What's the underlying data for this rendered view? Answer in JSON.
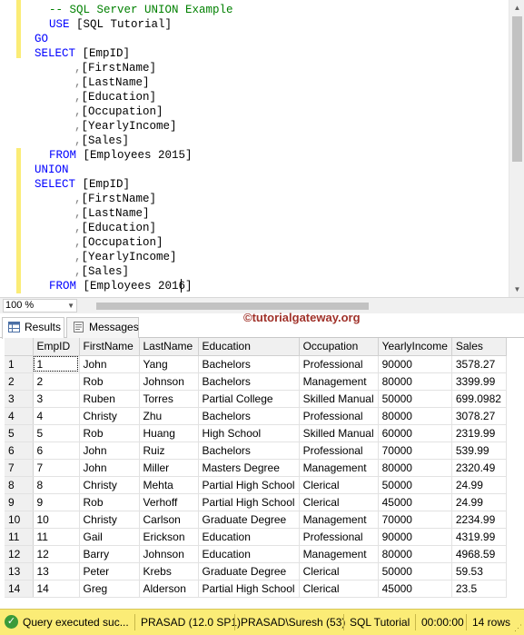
{
  "editor": {
    "lines": [
      {
        "parts": [
          {
            "cls": "cm",
            "t": "-- SQL Server UNION Example"
          }
        ],
        "indent": 54
      },
      {
        "parts": [
          {
            "cls": "kw",
            "t": "USE "
          },
          {
            "cls": "tx",
            "t": "[SQL Tutorial]"
          }
        ],
        "indent": 54
      },
      {
        "parts": [
          {
            "cls": "kw",
            "t": "GO"
          }
        ],
        "indent": 38
      },
      {
        "parts": [
          {
            "cls": "kw",
            "t": "SELECT "
          },
          {
            "cls": "tx",
            "t": "[EmpID]"
          }
        ],
        "indent": 38
      },
      {
        "parts": [
          {
            "cls": "gr",
            "t": ","
          },
          {
            "cls": "tx",
            "t": "[FirstName]"
          }
        ],
        "indent": 82
      },
      {
        "parts": [
          {
            "cls": "gr",
            "t": ","
          },
          {
            "cls": "tx",
            "t": "[LastName]"
          }
        ],
        "indent": 82
      },
      {
        "parts": [
          {
            "cls": "gr",
            "t": ","
          },
          {
            "cls": "tx",
            "t": "[Education]"
          }
        ],
        "indent": 82
      },
      {
        "parts": [
          {
            "cls": "gr",
            "t": ","
          },
          {
            "cls": "tx",
            "t": "[Occupation]"
          }
        ],
        "indent": 82
      },
      {
        "parts": [
          {
            "cls": "gr",
            "t": ","
          },
          {
            "cls": "tx",
            "t": "[YearlyIncome]"
          }
        ],
        "indent": 82
      },
      {
        "parts": [
          {
            "cls": "gr",
            "t": ","
          },
          {
            "cls": "tx",
            "t": "[Sales]"
          }
        ],
        "indent": 82
      },
      {
        "parts": [
          {
            "cls": "kw",
            "t": "FROM "
          },
          {
            "cls": "tx",
            "t": "[Employees 2015]"
          }
        ],
        "indent": 54
      },
      {
        "parts": [
          {
            "cls": "kw",
            "t": "UNION"
          }
        ],
        "indent": 38
      },
      {
        "parts": [
          {
            "cls": "kw",
            "t": "SELECT "
          },
          {
            "cls": "tx",
            "t": "[EmpID]"
          }
        ],
        "indent": 38
      },
      {
        "parts": [
          {
            "cls": "gr",
            "t": ","
          },
          {
            "cls": "tx",
            "t": "[FirstName]"
          }
        ],
        "indent": 82
      },
      {
        "parts": [
          {
            "cls": "gr",
            "t": ","
          },
          {
            "cls": "tx",
            "t": "[LastName]"
          }
        ],
        "indent": 82
      },
      {
        "parts": [
          {
            "cls": "gr",
            "t": ","
          },
          {
            "cls": "tx",
            "t": "[Education]"
          }
        ],
        "indent": 82
      },
      {
        "parts": [
          {
            "cls": "gr",
            "t": ","
          },
          {
            "cls": "tx",
            "t": "[Occupation]"
          }
        ],
        "indent": 82
      },
      {
        "parts": [
          {
            "cls": "gr",
            "t": ","
          },
          {
            "cls": "tx",
            "t": "[YearlyIncome]"
          }
        ],
        "indent": 82
      },
      {
        "parts": [
          {
            "cls": "gr",
            "t": ","
          },
          {
            "cls": "tx",
            "t": "[Sales]"
          }
        ],
        "indent": 82
      },
      {
        "parts": [
          {
            "cls": "kw",
            "t": "FROM "
          },
          {
            "cls": "tx",
            "t": "[Employees 2016]"
          }
        ],
        "indent": 54
      }
    ]
  },
  "zoom": {
    "value": "100 %"
  },
  "tabs": {
    "results": "Results",
    "messages": "Messages"
  },
  "watermark": "©tutorialgateway.org",
  "grid": {
    "columns": [
      "EmpID",
      "FirstName",
      "LastName",
      "Education",
      "Occupation",
      "YearlyIncome",
      "Sales"
    ],
    "rows": [
      [
        "1",
        "1",
        "John",
        "Yang",
        "Bachelors",
        "Professional",
        "90000",
        "3578.27"
      ],
      [
        "2",
        "2",
        "Rob",
        "Johnson",
        "Bachelors",
        "Management",
        "80000",
        "3399.99"
      ],
      [
        "3",
        "3",
        "Ruben",
        "Torres",
        "Partial College",
        "Skilled Manual",
        "50000",
        "699.0982"
      ],
      [
        "4",
        "4",
        "Christy",
        "Zhu",
        "Bachelors",
        "Professional",
        "80000",
        "3078.27"
      ],
      [
        "5",
        "5",
        "Rob",
        "Huang",
        "High School",
        "Skilled Manual",
        "60000",
        "2319.99"
      ],
      [
        "6",
        "6",
        "John",
        "Ruiz",
        "Bachelors",
        "Professional",
        "70000",
        "539.99"
      ],
      [
        "7",
        "7",
        "John",
        "Miller",
        "Masters Degree",
        "Management",
        "80000",
        "2320.49"
      ],
      [
        "8",
        "8",
        "Christy",
        "Mehta",
        "Partial High School",
        "Clerical",
        "50000",
        "24.99"
      ],
      [
        "9",
        "9",
        "Rob",
        "Verhoff",
        "Partial High School",
        "Clerical",
        "45000",
        "24.99"
      ],
      [
        "10",
        "10",
        "Christy",
        "Carlson",
        "Graduate Degree",
        "Management",
        "70000",
        "2234.99"
      ],
      [
        "11",
        "11",
        "Gail",
        "Erickson",
        "Education",
        "Professional",
        "90000",
        "4319.99"
      ],
      [
        "12",
        "12",
        "Barry",
        "Johnson",
        "Education",
        "Management",
        "80000",
        "4968.59"
      ],
      [
        "13",
        "13",
        "Peter",
        "Krebs",
        "Graduate Degree",
        "Clerical",
        "50000",
        "59.53"
      ],
      [
        "14",
        "14",
        "Greg",
        "Alderson",
        "Partial High School",
        "Clerical",
        "45000",
        "23.5"
      ]
    ]
  },
  "status": {
    "message": "Query executed suc...",
    "server": "PRASAD (12.0 SP1)",
    "user": "PRASAD\\Suresh (53)",
    "database": "SQL Tutorial",
    "elapsed": "00:00:00",
    "rows": "14 rows"
  }
}
